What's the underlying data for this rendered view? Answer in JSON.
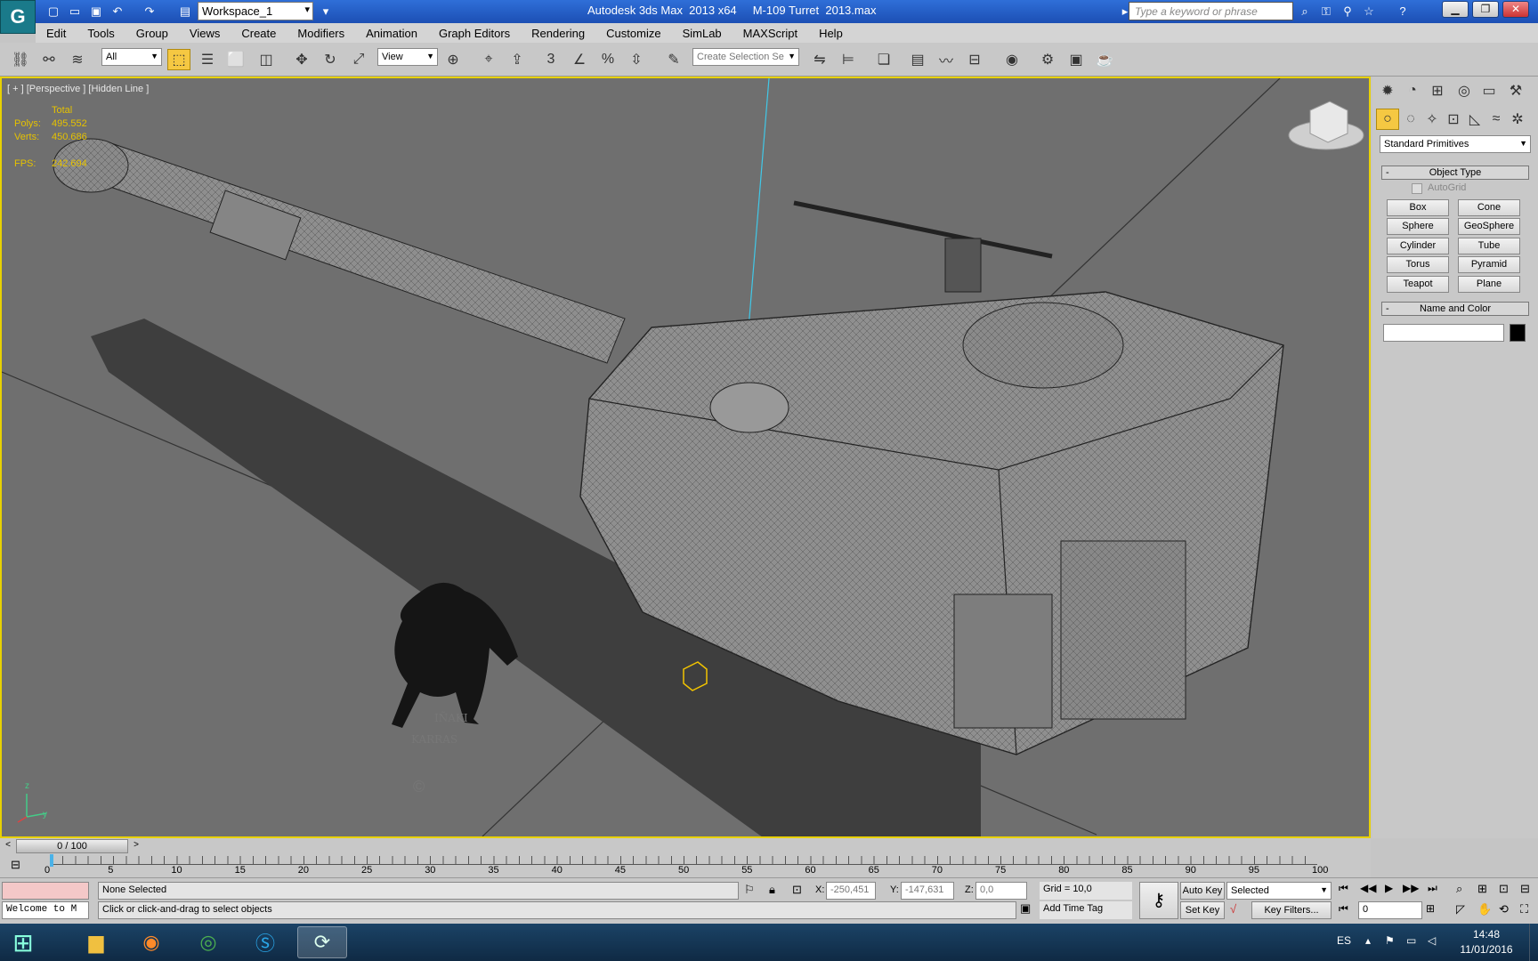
{
  "titlebar": {
    "logo": "G",
    "workspace": "Workspace_1",
    "app_title": "Autodesk 3ds Max  2013 x64     M-109 Turret  2013.max",
    "search_placeholder": "Type a keyword or phrase"
  },
  "menu": [
    "Edit",
    "Tools",
    "Group",
    "Views",
    "Create",
    "Modifiers",
    "Animation",
    "Graph Editors",
    "Rendering",
    "Customize",
    "SimLab",
    "MAXScript",
    "Help"
  ],
  "toolbar": {
    "filter": "All",
    "ref_coord": "View",
    "snap_label": "3",
    "selection_set_placeholder": "Create Selection Se"
  },
  "viewport": {
    "label": "[ + ] [Perspective ] [Hidden Line ]",
    "stats_header": "Total",
    "polys_label": "Polys:",
    "polys_value": "495.552",
    "verts_label": "Verts:",
    "verts_value": "450.686",
    "fps_label": "FPS:",
    "fps_value": "242.694",
    "watermark_lines": [
      "IÑAKI",
      "KARRAS",
      "©"
    ],
    "axis_z": "z",
    "axis_y": "y"
  },
  "command_panel": {
    "category": "Standard Primitives",
    "object_type_title": "Object Type",
    "autogrid": "AutoGrid",
    "buttons": [
      "Box",
      "Cone",
      "Sphere",
      "GeoSphere",
      "Cylinder",
      "Tube",
      "Torus",
      "Pyramid",
      "Teapot",
      "Plane"
    ],
    "name_color_title": "Name and Color",
    "name_value": ""
  },
  "timeline": {
    "frame_display": "0 / 100",
    "ticks": [
      "0",
      "5",
      "10",
      "15",
      "20",
      "25",
      "30",
      "35",
      "40",
      "45",
      "50",
      "55",
      "60",
      "65",
      "70",
      "75",
      "80",
      "85",
      "90",
      "95",
      "100"
    ]
  },
  "status": {
    "listener": "Welcome to M",
    "selection": "None Selected",
    "prompt": "Click or click-and-drag to select objects",
    "x_label": "X:",
    "x_value": "-250,451",
    "y_label": "Y:",
    "y_value": "-147,631",
    "z_label": "Z:",
    "z_value": "0,0",
    "grid": "Grid = 10,0",
    "add_time_tag": "Add Time Tag",
    "auto_key": "Auto Key",
    "set_key": "Set Key",
    "key_mode": "Selected",
    "key_filters": "Key Filters...",
    "current_frame": "0"
  },
  "taskbar": {
    "lang": "ES",
    "time": "14:48",
    "date": "11/01/2016"
  },
  "colors": {
    "viewport_bg": "#6f6f6f",
    "viewport_border": "#e8d100",
    "stats": "#e6c200",
    "titlebar": "#1c4fb4"
  }
}
